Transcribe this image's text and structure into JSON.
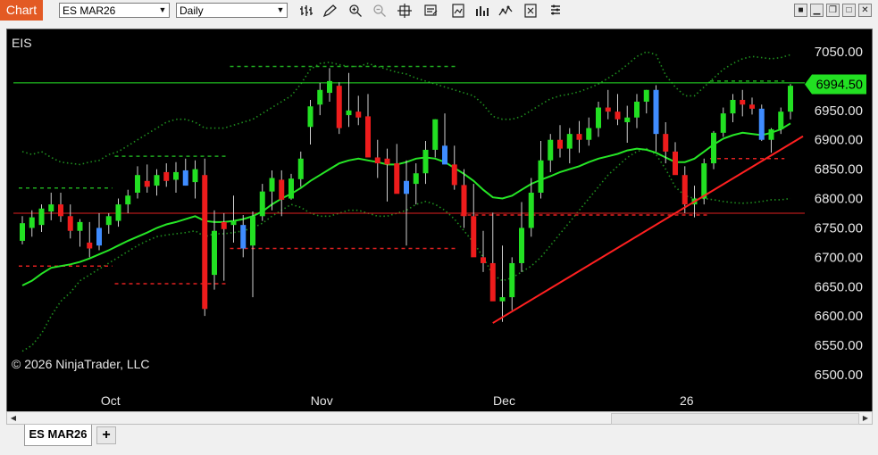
{
  "app": {
    "title": "Chart"
  },
  "toolbar": {
    "instrument": "ES MAR26",
    "interval": "Daily",
    "icons": [
      "bar-type-icon",
      "drawing-tool-icon",
      "zoom-in-icon",
      "zoom-out-icon",
      "crosshair-icon",
      "data-box-icon",
      "indicators-icon",
      "strategies-icon",
      "chart-trader-icon",
      "templates-icon",
      "properties-icon"
    ]
  },
  "window": {
    "minimize": "▁",
    "restore": "❐",
    "maximize": "□",
    "close": "✕"
  },
  "tabs": [
    {
      "label": "ES MAR26"
    }
  ],
  "colors": {
    "bull": "#22e022",
    "bear": "#ee1c1c",
    "neutral": "#3f8cff",
    "background": "#000000",
    "sma": "#26e626",
    "bands": "#1f8f1f",
    "trendline": "#ff2020",
    "price_marker": "#22e022"
  },
  "chart_data": {
    "type": "candlestick",
    "symbol_label": "EIS",
    "watermark": "© 2026 NinjaTrader, LLC",
    "current_price": "6994.50",
    "y_ticks": [
      "7050.00",
      "7000.00",
      "6950.00",
      "6900.00",
      "6850.00",
      "6800.00",
      "6750.00",
      "6700.00",
      "6650.00",
      "6600.00",
      "6550.00",
      "6500.00"
    ],
    "ylim": [
      6490,
      7080
    ],
    "x_labels": [
      {
        "label": "Oct",
        "index": 9
      },
      {
        "label": "Nov",
        "index": 31
      },
      {
        "label": "Dec",
        "index": 50
      },
      {
        "label": "26",
        "index": 69
      }
    ],
    "candles": [
      [
        6728,
        6770,
        6722,
        6758
      ],
      [
        6750,
        6780,
        6735,
        6768
      ],
      [
        6755,
        6790,
        6743,
        6783
      ],
      [
        6778,
        6810,
        6763,
        6790
      ],
      [
        6790,
        6810,
        6760,
        6770
      ],
      [
        6770,
        6790,
        6732,
        6745
      ],
      [
        6745,
        6765,
        6718,
        6760
      ],
      [
        6725,
        6760,
        6700,
        6715
      ],
      [
        6720,
        6775,
        6712,
        6750
      ],
      [
        6755,
        6775,
        6740,
        6770
      ],
      [
        6762,
        6800,
        6752,
        6790
      ],
      [
        6790,
        6815,
        6775,
        6805
      ],
      [
        6810,
        6855,
        6800,
        6840
      ],
      [
        6830,
        6858,
        6810,
        6820
      ],
      [
        6822,
        6850,
        6805,
        6840
      ],
      [
        6845,
        6860,
        6820,
        6830
      ],
      [
        6832,
        6862,
        6810,
        6845
      ],
      [
        6848,
        6868,
        6822,
        6822
      ],
      [
        6828,
        6865,
        6800,
        6850
      ],
      [
        6840,
        6868,
        6600,
        6612
      ],
      [
        6670,
        6780,
        6645,
        6745
      ],
      [
        6760,
        6775,
        6660,
        6748
      ],
      [
        6755,
        6805,
        6725,
        6762
      ],
      [
        6755,
        6772,
        6700,
        6715
      ],
      [
        6720,
        6778,
        6632,
        6770
      ],
      [
        6770,
        6825,
        6762,
        6812
      ],
      [
        6812,
        6848,
        6780,
        6835
      ],
      [
        6832,
        6848,
        6770,
        6798
      ],
      [
        6800,
        6842,
        6798,
        6834
      ],
      [
        6833,
        6880,
        6820,
        6868
      ],
      [
        6922,
        6968,
        6892,
        6957
      ],
      [
        6960,
        6997,
        6942,
        6985
      ],
      [
        6980,
        7022,
        6965,
        7000
      ],
      [
        6992,
        6998,
        6910,
        6920
      ],
      [
        6942,
        7014,
        6922,
        6950
      ],
      [
        6948,
        6975,
        6925,
        6938
      ],
      [
        6940,
        6978,
        6900,
        6870
      ],
      [
        6870,
        6900,
        6835,
        6860
      ],
      [
        6868,
        6885,
        6795,
        6858
      ],
      [
        6860,
        6893,
        6810,
        6808
      ],
      [
        6808,
        6865,
        6720,
        6830
      ],
      [
        6825,
        6860,
        6790,
        6843
      ],
      [
        6843,
        6898,
        6825,
        6883
      ],
      [
        6883,
        6935,
        6870,
        6935
      ],
      [
        6890,
        6945,
        6865,
        6858
      ],
      [
        6858,
        6890,
        6815,
        6823
      ],
      [
        6823,
        6850,
        6750,
        6770
      ],
      [
        6770,
        6825,
        6720,
        6700
      ],
      [
        6700,
        6745,
        6675,
        6690
      ],
      [
        6690,
        6776,
        6645,
        6625
      ],
      [
        6625,
        6720,
        6590,
        6632
      ],
      [
        6632,
        6700,
        6610,
        6690
      ],
      [
        6690,
        6794,
        6675,
        6750
      ],
      [
        6750,
        6835,
        6735,
        6810
      ],
      [
        6810,
        6898,
        6800,
        6865
      ],
      [
        6865,
        6910,
        6845,
        6900
      ],
      [
        6900,
        6925,
        6870,
        6885
      ],
      [
        6885,
        6920,
        6860,
        6910
      ],
      [
        6910,
        6932,
        6878,
        6900
      ],
      [
        6900,
        6938,
        6890,
        6920
      ],
      [
        6920,
        6965,
        6905,
        6955
      ],
      [
        6955,
        6985,
        6935,
        6948
      ],
      [
        6948,
        6978,
        6925,
        6935
      ],
      [
        6930,
        6958,
        6895,
        6938
      ],
      [
        6938,
        6978,
        6920,
        6965
      ],
      [
        6965,
        6985,
        6945,
        6985
      ],
      [
        6985,
        6993,
        6880,
        6910
      ],
      [
        6910,
        6930,
        6860,
        6880
      ],
      [
        6880,
        6896,
        6850,
        6840
      ],
      [
        6840,
        6855,
        6775,
        6790
      ],
      [
        6790,
        6822,
        6768,
        6800
      ],
      [
        6800,
        6868,
        6790,
        6860
      ],
      [
        6860,
        6915,
        6850,
        6912
      ],
      [
        6912,
        6955,
        6905,
        6945
      ],
      [
        6945,
        6978,
        6930,
        6968
      ],
      [
        6968,
        6985,
        6940,
        6960
      ],
      [
        6960,
        6972,
        6943,
        6953
      ],
      [
        6953,
        6960,
        6898,
        6900
      ],
      [
        6900,
        6920,
        6878,
        6918
      ],
      [
        6918,
        6955,
        6910,
        6948
      ],
      [
        6948,
        6995,
        6935,
        6992
      ]
    ],
    "neutral_indices": [
      8,
      17,
      23,
      40,
      44,
      66,
      77
    ],
    "sma": [
      6652,
      6660,
      6672,
      6682,
      6685,
      6688,
      6692,
      6698,
      6705,
      6712,
      6720,
      6728,
      6735,
      6742,
      6750,
      6756,
      6760,
      6765,
      6770,
      6762,
      6760,
      6760,
      6762,
      6765,
      6770,
      6778,
      6790,
      6800,
      6808,
      6818,
      6830,
      6840,
      6850,
      6860,
      6865,
      6868,
      6865,
      6862,
      6858,
      6858,
      6862,
      6868,
      6870,
      6868,
      6862,
      6852,
      6842,
      6830,
      6815,
      6802,
      6800,
      6805,
      6815,
      6825,
      6832,
      6838,
      6845,
      6850,
      6855,
      6862,
      6868,
      6872,
      6876,
      6882,
      6885,
      6883,
      6878,
      6870,
      6862,
      6862,
      6868,
      6880,
      6892,
      6902,
      6908,
      6912,
      6910,
      6908,
      6912,
      6918,
      6928
    ],
    "upper_band": [
      6880,
      6875,
      6880,
      6870,
      6862,
      6860,
      6858,
      6862,
      6865,
      6875,
      6880,
      6890,
      6900,
      6910,
      6920,
      6930,
      6935,
      6935,
      6930,
      6920,
      6920,
      6920,
      6925,
      6930,
      6935,
      6945,
      6955,
      6965,
      6975,
      6995,
      7020,
      7030,
      7032,
      7028,
      7025,
      7025,
      7030,
      7025,
      7020,
      7015,
      7012,
      7005,
      7000,
      6995,
      6990,
      6985,
      6980,
      6975,
      6960,
      6940,
      6935,
      6935,
      6940,
      6950,
      6960,
      6970,
      6975,
      6978,
      6982,
      6988,
      6995,
      7005,
      7015,
      7028,
      7042,
      7050,
      7045,
      7010,
      6990,
      6975,
      6975,
      6990,
      7005,
      7020,
      7030,
      7038,
      7042,
      7040,
      7038,
      7040,
      7045
    ],
    "lower_band": [
      6540,
      6550,
      6570,
      6600,
      6625,
      6640,
      6660,
      6670,
      6680,
      6690,
      6700,
      6710,
      6720,
      6728,
      6735,
      6738,
      6740,
      6742,
      6745,
      6735,
      6740,
      6740,
      6742,
      6745,
      6750,
      6758,
      6770,
      6780,
      6790,
      6785,
      6775,
      6770,
      6770,
      6775,
      6780,
      6780,
      6775,
      6770,
      6770,
      6775,
      6780,
      6790,
      6795,
      6790,
      6780,
      6765,
      6745,
      6725,
      6700,
      6670,
      6660,
      6665,
      6675,
      6685,
      6700,
      6720,
      6740,
      6760,
      6780,
      6800,
      6820,
      6840,
      6855,
      6870,
      6880,
      6885,
      6875,
      6850,
      6820,
      6805,
      6800,
      6800,
      6798,
      6795,
      6793,
      6792,
      6793,
      6795,
      6798,
      6798,
      6800
    ],
    "horizontal_lines": [
      {
        "price": 6997,
        "color": "green",
        "style": "solid",
        "from": 0,
        "to": 80
      },
      {
        "price": 6775,
        "color": "red",
        "style": "solid",
        "from": 0,
        "to": 80
      }
    ],
    "dashed_levels": [
      {
        "price": 6818,
        "from": 0,
        "to": 9,
        "color": "green"
      },
      {
        "price": 6685,
        "from": 0,
        "to": 9,
        "color": "red"
      },
      {
        "price": 6872,
        "from": 10,
        "to": 21,
        "color": "green"
      },
      {
        "price": 6655,
        "from": 10,
        "to": 21,
        "color": "red"
      },
      {
        "price": 7025,
        "from": 22,
        "to": 45,
        "color": "green"
      },
      {
        "price": 6715,
        "from": 22,
        "to": 45,
        "color": "red"
      },
      {
        "price": 6772,
        "from": 46,
        "to": 71,
        "color": "red"
      },
      {
        "price": 7000,
        "from": 72,
        "to": 79,
        "color": "green"
      },
      {
        "price": 6868,
        "from": 72,
        "to": 79,
        "color": "red"
      }
    ],
    "trendline": {
      "from": [
        49,
        6588
      ],
      "to": [
        80,
        6906
      ]
    }
  }
}
